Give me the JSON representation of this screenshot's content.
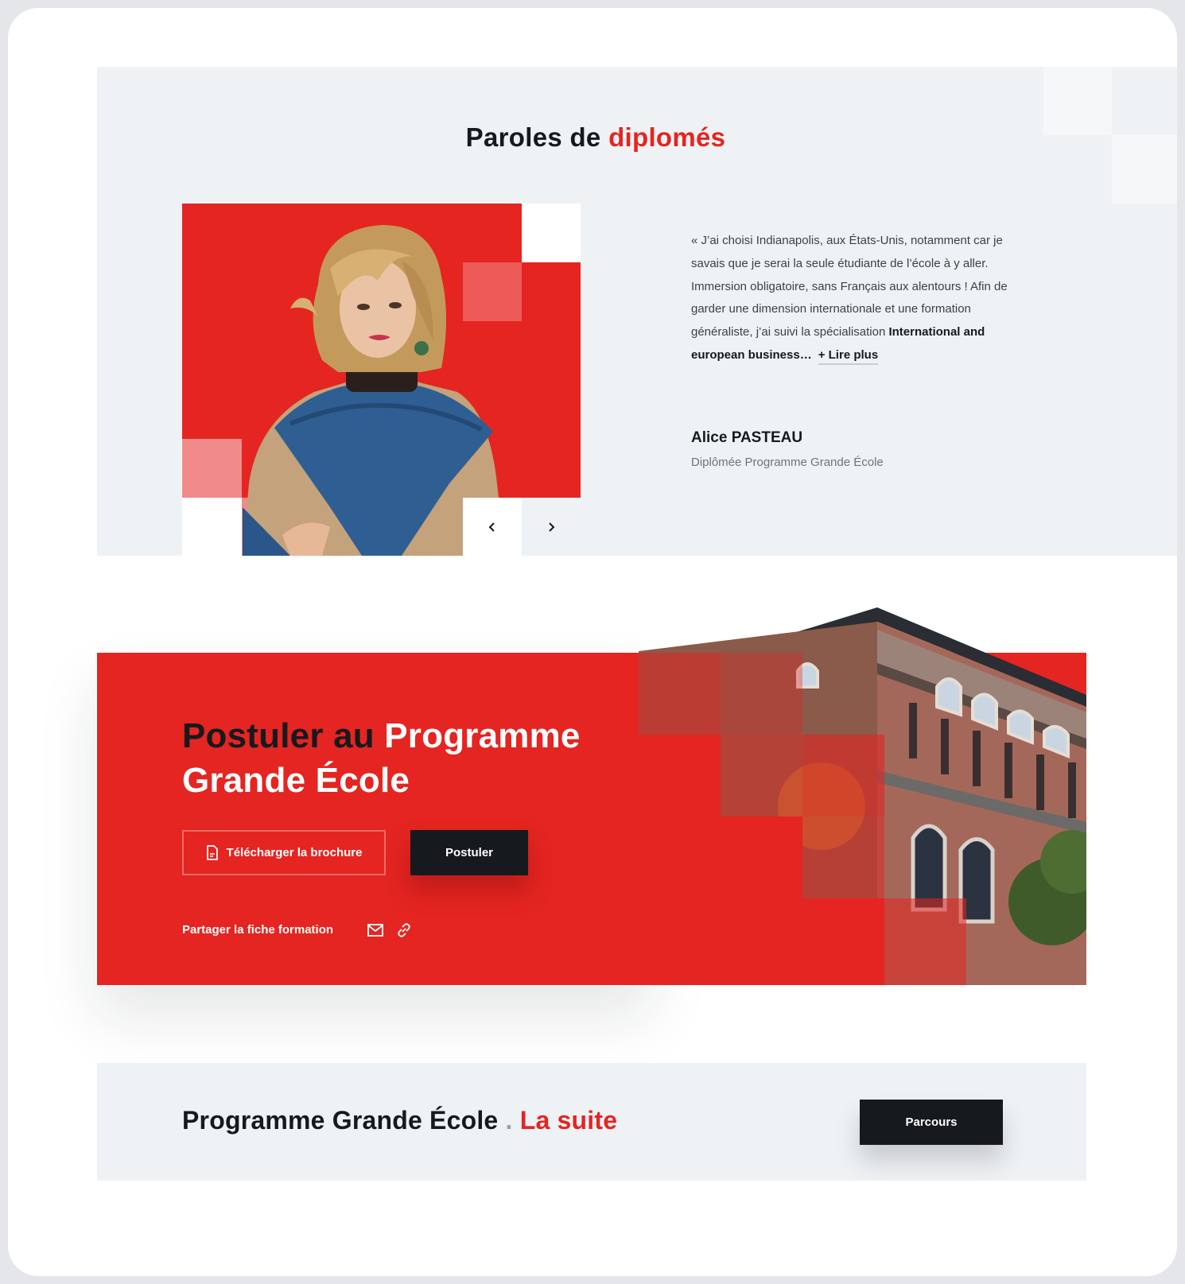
{
  "testimonials": {
    "title_main": "Paroles de ",
    "title_accent": "diplomés",
    "quote_part1": "« J’ai choisi Indianapolis, aux États-Unis, notamment car je savais que je serai la seule étudiante de l’école à y aller. Immersion obligatoire, sans Français aux alentours ! Afin de garder une dimension internationale et une formation généraliste, j’ai suivi la spécialisation ",
    "quote_bold": "International and european business…",
    "read_more": "+ Lire plus",
    "name": "Alice PASTEAU",
    "role": "Diplômée Programme Grande École"
  },
  "apply": {
    "title_dark": "Postuler au ",
    "title_light": "Programme Grande École",
    "brochure_label": "Télécharger la brochure",
    "apply_label": "Postuler",
    "share_label": "Partager la fiche formation"
  },
  "next": {
    "title": "Programme Grande École",
    "dot": ".",
    "accent": "La suite",
    "button_label": "Parcours"
  },
  "icons": {
    "prev": "chevron-left-icon",
    "next": "chevron-right-icon",
    "brochure": "document-icon",
    "mail": "mail-icon",
    "link": "link-icon"
  },
  "colors": {
    "accent_red": "#e42521",
    "dark": "#16191d",
    "light_bg": "#eff2f5"
  }
}
